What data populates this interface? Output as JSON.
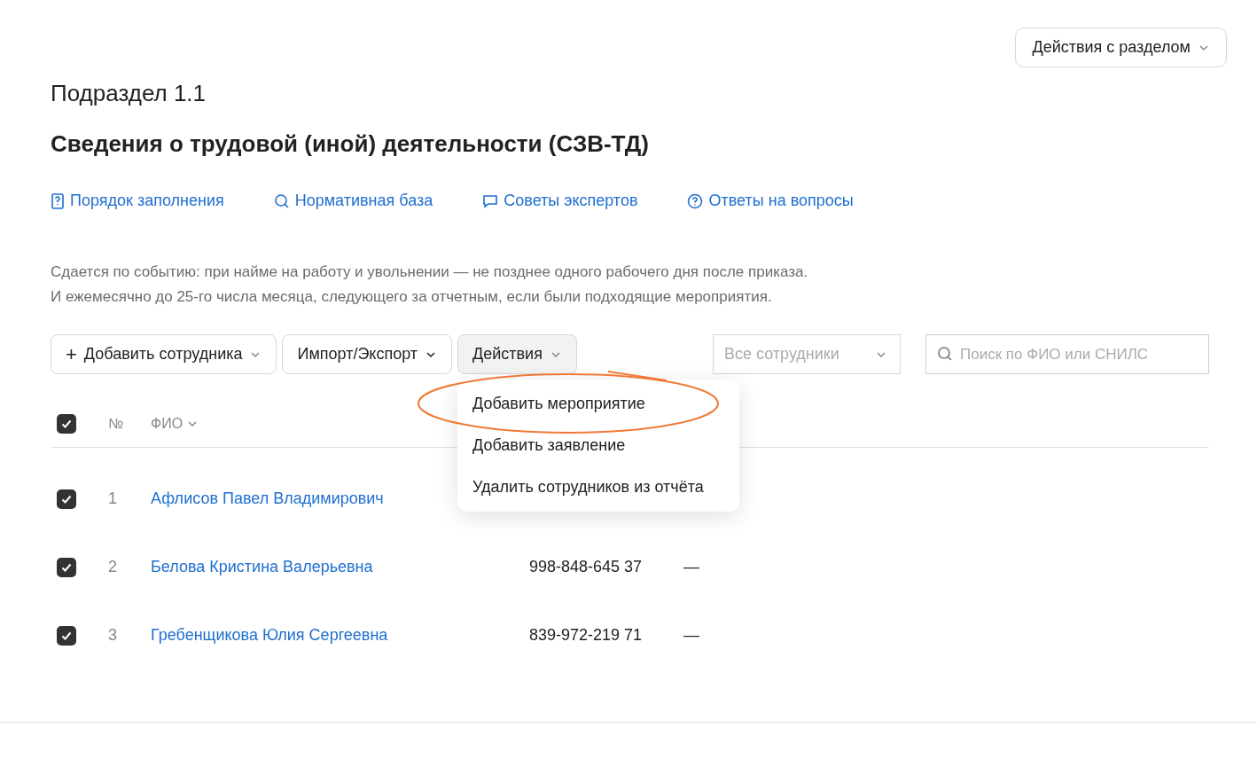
{
  "section_actions": {
    "label": "Действия с разделом"
  },
  "subtitle": "Подраздел 1.1",
  "title": "Сведения о трудовой (иной) деятельности (СЗВ-ТД)",
  "links": [
    {
      "kind": "book",
      "label": "Порядок заполнения"
    },
    {
      "kind": "search",
      "label": "Нормативная база"
    },
    {
      "kind": "chat",
      "label": "Советы экспертов"
    },
    {
      "kind": "help",
      "label": "Ответы на вопросы"
    }
  ],
  "description": [
    "Сдается по событию: при найме на работу и увольнении — не позднее одного рабочего дня после приказа.",
    "И ежемесячно до 25-го числа месяца, следующего за отчетным, если были подходящие мероприятия."
  ],
  "toolbar": {
    "add_button": {
      "icon": "+",
      "label": "Добавить сотрудника"
    },
    "import_button": "Импорт/Экспорт",
    "actions_button": {
      "label": "Действия",
      "expanded": true
    },
    "filter": {
      "placeholder": "Все сотрудники"
    },
    "search": {
      "placeholder": "Поиск по ФИО или СНИЛС"
    }
  },
  "actions_menu": [
    {
      "label": "Добавить мероприятие",
      "highlighted": true
    },
    {
      "label": "Добавить заявление",
      "highlighted": false
    },
    {
      "label": "Удалить сотрудников из отчёта",
      "highlighted": false
    }
  ],
  "table": {
    "select_all_checked": true,
    "columns": [
      "№",
      "ФИО"
    ],
    "rows": [
      {
        "checked": true,
        "number": "1",
        "name": "Афлисов Павел Владимирович"
      },
      {
        "checked": true,
        "number": "2",
        "name": "Белова Кристина Валерьевна",
        "snils": "998-848-645 37",
        "column_4": "—"
      },
      {
        "checked": true,
        "number": "3",
        "name": "Гребенщикова Юлия Сергеевна",
        "snils": "839-972-219 71",
        "column_4": "—"
      }
    ]
  }
}
